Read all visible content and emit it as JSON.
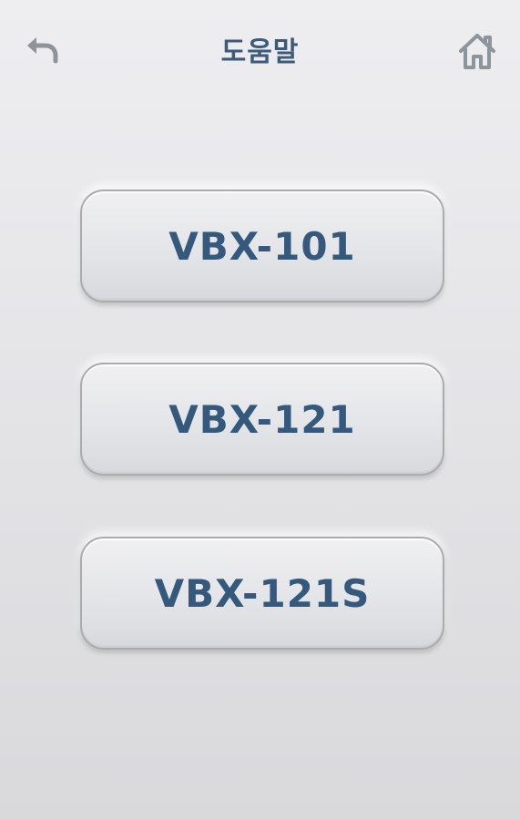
{
  "header": {
    "title": "도움말",
    "back_icon": "undo-arrow-icon",
    "home_icon": "home-icon"
  },
  "models": [
    {
      "label": "VBX-101"
    },
    {
      "label": "VBX-121"
    },
    {
      "label": "VBX-121S"
    }
  ],
  "colors": {
    "accent_text": "#35597c",
    "icon_gray": "#8e949b",
    "background_top": "#eeeef1",
    "background_bottom": "#d9d9dc"
  }
}
